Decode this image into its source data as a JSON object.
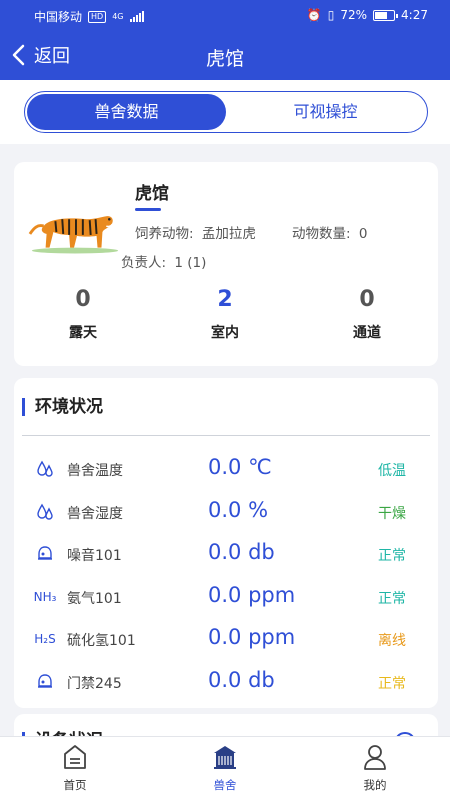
{
  "status_bar": {
    "carrier": "中国移动",
    "hd": "HD",
    "network": "4G",
    "battery": "72%",
    "battery_level": 0.72,
    "time": "4:27"
  },
  "nav": {
    "back_label": "返回",
    "title": "虎馆"
  },
  "segments": [
    {
      "label": "兽舍数据",
      "active": true
    },
    {
      "label": "可视操控",
      "active": false
    }
  ],
  "enclosure": {
    "name": "虎馆",
    "animal_label": "饲养动物:",
    "animal_value": "孟加拉虎",
    "count_label": "动物数量:",
    "count_value": "0",
    "keeper_label": "负责人:",
    "keeper_value": "1 (1)",
    "stats": [
      {
        "value": "0",
        "label": "露天"
      },
      {
        "value": "2",
        "label": "室内"
      },
      {
        "value": "0",
        "label": "通道"
      }
    ]
  },
  "environment": {
    "title": "环境状况",
    "rows": [
      {
        "icon": "drops-icon",
        "name": "兽舍温度",
        "value": "0.0 ℃",
        "status": "低温",
        "status_color": "#1fb6a6"
      },
      {
        "icon": "drops-icon",
        "name": "兽舍湿度",
        "value": "0.0 %",
        "status": "干燥",
        "status_color": "#3aa644"
      },
      {
        "icon": "sensor-icon",
        "name": "噪音101",
        "value": "0.0 db",
        "status": "正常",
        "status_color": "#1fb6a6"
      },
      {
        "icon": "nh3-icon",
        "icon_text": "NH₃",
        "name": "氨气101",
        "value": "0.0 ppm",
        "status": "正常",
        "status_color": "#1fb6a6"
      },
      {
        "icon": "h2s-icon",
        "icon_text": "H₂S",
        "name": "硫化氢101",
        "value": "0.0 ppm",
        "status": "离线",
        "status_color": "#e89a1c"
      },
      {
        "icon": "sensor-icon",
        "name": "门禁245",
        "value": "0.0 db",
        "status": "正常",
        "status_color": "#e8b91c"
      }
    ]
  },
  "device": {
    "title": "设备状况"
  },
  "tabbar": [
    {
      "label": "首页",
      "icon": "home-icon",
      "active": false
    },
    {
      "label": "兽舍",
      "icon": "building-icon",
      "active": true
    },
    {
      "label": "我的",
      "icon": "user-icon",
      "active": false
    }
  ],
  "colors": {
    "primary": "#2f4fd6",
    "background": "#f2f3f7"
  }
}
